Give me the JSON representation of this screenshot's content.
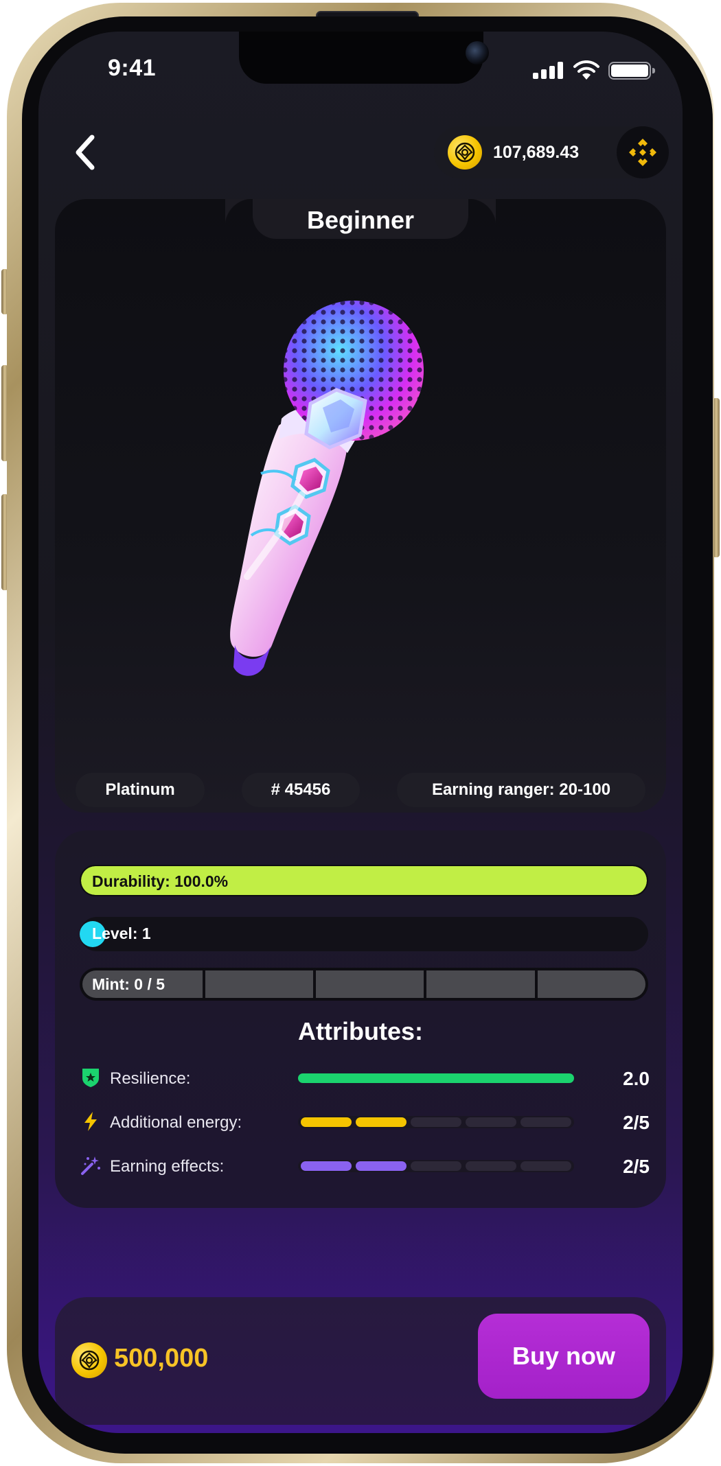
{
  "status_bar": {
    "time": "9:41"
  },
  "header": {
    "balance": "107,689.43",
    "icons": [
      "back-chevron-icon",
      "coin-icon",
      "binance-icon"
    ]
  },
  "nft": {
    "tier": "Beginner",
    "rarity": "Platinum",
    "id": "# 45456",
    "earning_range": "Earning ranger: 20-100"
  },
  "stats": {
    "durability_label": "Durability: 100.0%",
    "durability_fraction": 1.0,
    "level_label": "Level: 1",
    "mint_label": "Mint: 0 / 5",
    "mint_used": 0,
    "mint_total": 5
  },
  "attributes": {
    "title": "Attributes:",
    "items": [
      {
        "label": "Resilience:",
        "value": "2.0",
        "icon": "shield-star-icon",
        "color": "#1bd36e",
        "filled": 1,
        "total": 1
      },
      {
        "label": "Additional energy:",
        "value": "2/5",
        "icon": "lightning-icon",
        "color": "#f5c400",
        "filled": 2,
        "total": 5
      },
      {
        "label": "Earning effects:",
        "value": "2/5",
        "icon": "magic-wand-icon",
        "color": "#8a62f0",
        "filled": 2,
        "total": 5
      }
    ]
  },
  "purchase": {
    "price": "500,000",
    "button_label": "Buy now"
  },
  "colors": {
    "accent": "#b52ed6",
    "durability": "#c1ee45",
    "level": "#22d8f2",
    "price": "#f7c326"
  }
}
